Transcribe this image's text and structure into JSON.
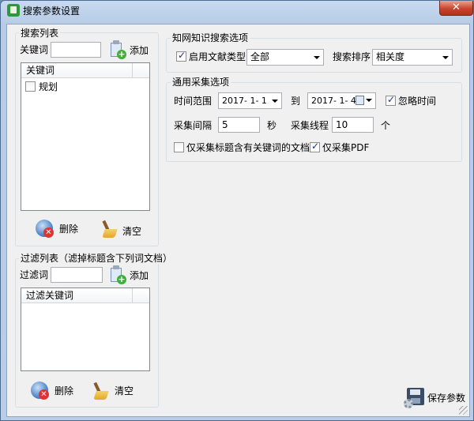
{
  "window": {
    "title": "搜索参数设置",
    "close": "✕"
  },
  "search_list": {
    "group_title": "搜索列表",
    "keyword_label": "关键词",
    "keyword_value": "",
    "add_label": "添加",
    "column_header": "关键词",
    "items": [
      {
        "label": "规划",
        "checked": false
      }
    ],
    "delete_label": "删除",
    "clear_label": "清空"
  },
  "filter_list": {
    "group_title": "过滤列表（滤掉标题含下列词文档）",
    "keyword_label": "过滤词",
    "keyword_value": "",
    "add_label": "添加",
    "column_header": "过滤关键词",
    "items": [],
    "delete_label": "删除",
    "clear_label": "清空"
  },
  "cnki_options": {
    "group_title": "知网知识搜索选项",
    "enable_label": "启用",
    "enable_checked": true,
    "doc_type_label": "文献类型",
    "doc_type_value": "全部",
    "sort_label": "搜索排序",
    "sort_value": "相关度"
  },
  "general_options": {
    "group_title": "通用采集选项",
    "time_range_label": "时间范围",
    "date_from": "2017- 1- 1",
    "to_label": "到",
    "date_to": "2017- 1- 4",
    "ignore_time_label": "忽略时间",
    "ignore_time_checked": true,
    "interval_label": "采集间隔",
    "interval_value": "5",
    "interval_unit": "秒",
    "threads_label": "采集线程",
    "threads_value": "10",
    "threads_unit": "个",
    "title_keyword_only_label": "仅采集标题含有关键词的文档",
    "title_keyword_only_checked": false,
    "pdf_only_label": "仅采集PDF",
    "pdf_only_checked": true
  },
  "save_label": "保存参数"
}
